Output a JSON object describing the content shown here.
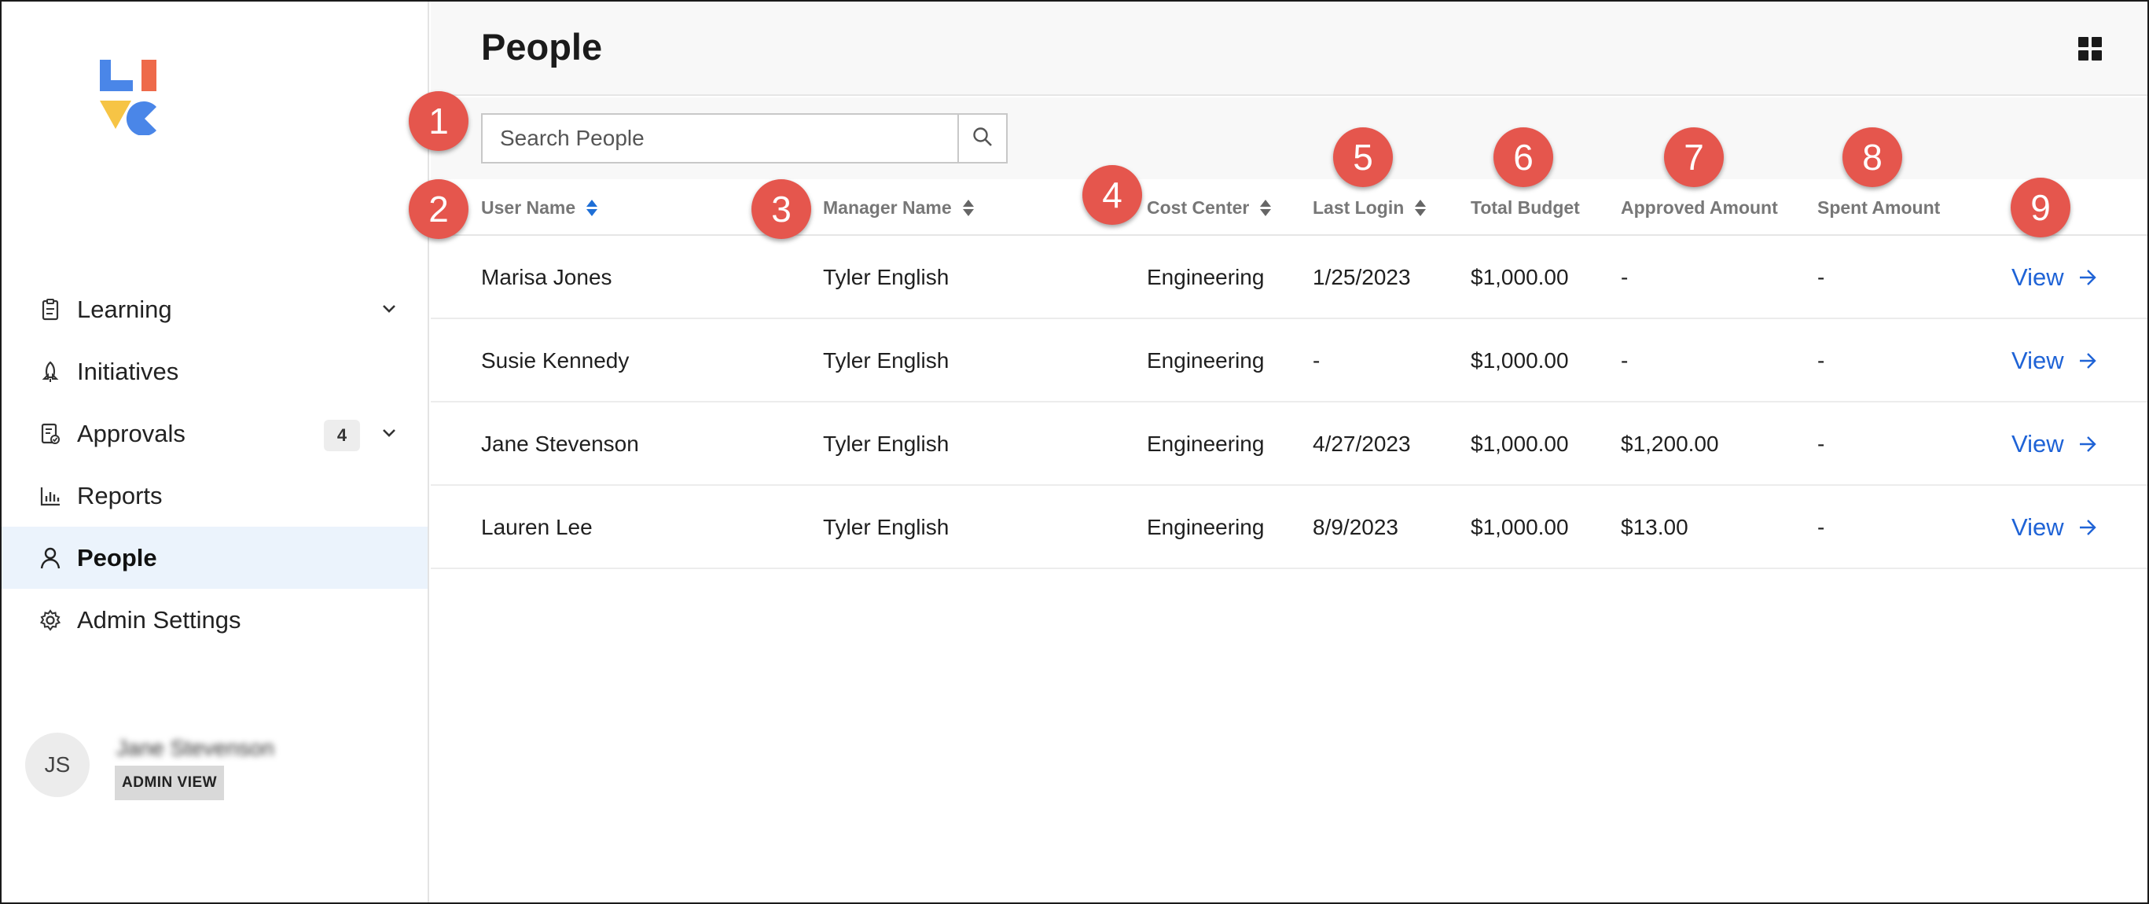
{
  "sidebar": {
    "nav": [
      {
        "label": "Learning",
        "icon": "clipboard-icon",
        "has_chevron": true
      },
      {
        "label": "Initiatives",
        "icon": "rocket-icon",
        "has_chevron": false
      },
      {
        "label": "Approvals",
        "icon": "approvals-icon",
        "has_chevron": true,
        "badge": "4"
      },
      {
        "label": "Reports",
        "icon": "bar-chart-icon",
        "has_chevron": false
      },
      {
        "label": "People",
        "icon": "person-icon",
        "has_chevron": false,
        "active": true
      },
      {
        "label": "Admin Settings",
        "icon": "gear-icon",
        "has_chevron": false
      }
    ],
    "user": {
      "initials": "JS",
      "name": "Jane Stevenson",
      "role_badge": "ADMIN VIEW"
    }
  },
  "header": {
    "title": "People"
  },
  "search": {
    "placeholder": "Search People"
  },
  "table": {
    "columns": [
      {
        "label": "User Name",
        "sortable": true,
        "active_sort": true
      },
      {
        "label": "Manager Name",
        "sortable": true
      },
      {
        "label": "Cost Center",
        "sortable": true
      },
      {
        "label": "Last Login",
        "sortable": true
      },
      {
        "label": "Total Budget",
        "sortable": false
      },
      {
        "label": "Approved Amount",
        "sortable": false
      },
      {
        "label": "Spent Amount",
        "sortable": false
      }
    ],
    "view_label": "View",
    "rows": [
      {
        "user": "Marisa Jones",
        "manager": "Tyler English",
        "cost_center": "Engineering",
        "last_login": "1/25/2023",
        "total_budget": "$1,000.00",
        "approved": "-",
        "spent": "-"
      },
      {
        "user": "Susie Kennedy",
        "manager": "Tyler English",
        "cost_center": "Engineering",
        "last_login": "-",
        "total_budget": "$1,000.00",
        "approved": "-",
        "spent": "-"
      },
      {
        "user": "Jane Stevenson",
        "manager": "Tyler English",
        "cost_center": "Engineering",
        "last_login": "4/27/2023",
        "total_budget": "$1,000.00",
        "approved": "$1,200.00",
        "spent": "-"
      },
      {
        "user": "Lauren Lee",
        "manager": "Tyler English",
        "cost_center": "Engineering",
        "last_login": "8/9/2023",
        "total_budget": "$1,000.00",
        "approved": "$13.00",
        "spent": "-"
      }
    ]
  },
  "callouts": [
    "1",
    "2",
    "3",
    "4",
    "5",
    "6",
    "7",
    "8",
    "9"
  ],
  "colors": {
    "accent": "#1f63d6",
    "callout": "#e5564d",
    "active_nav_bg": "#ebf3fc"
  }
}
